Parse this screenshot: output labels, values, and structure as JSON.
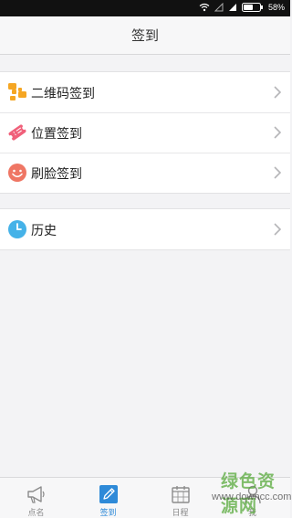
{
  "status_bar": {
    "battery": "58%"
  },
  "header": {
    "title": "签到"
  },
  "menu_group_1": [
    {
      "label": "二维码签到",
      "icon": "qr-code-icon"
    },
    {
      "label": "位置签到",
      "icon": "ticket-icon"
    },
    {
      "label": "刷脸签到",
      "icon": "smiley-face-icon"
    }
  ],
  "menu_group_2": [
    {
      "label": "历史",
      "icon": "clock-icon"
    }
  ],
  "tabs": [
    {
      "label": "点名",
      "icon": "megaphone-icon",
      "active": false
    },
    {
      "label": "签到",
      "icon": "pencil-icon",
      "active": true
    },
    {
      "label": "日程",
      "icon": "calendar-icon",
      "active": false
    },
    {
      "label": "我",
      "icon": "person-icon",
      "active": false
    }
  ],
  "watermark": {
    "title": "绿色资源网",
    "url": "www.downcc.com"
  },
  "colors": {
    "accent": "#2e8ad8",
    "qr": "#f5a623",
    "ticket": "#f0607a",
    "face": "#ef7664",
    "clock": "#45b2e8"
  }
}
